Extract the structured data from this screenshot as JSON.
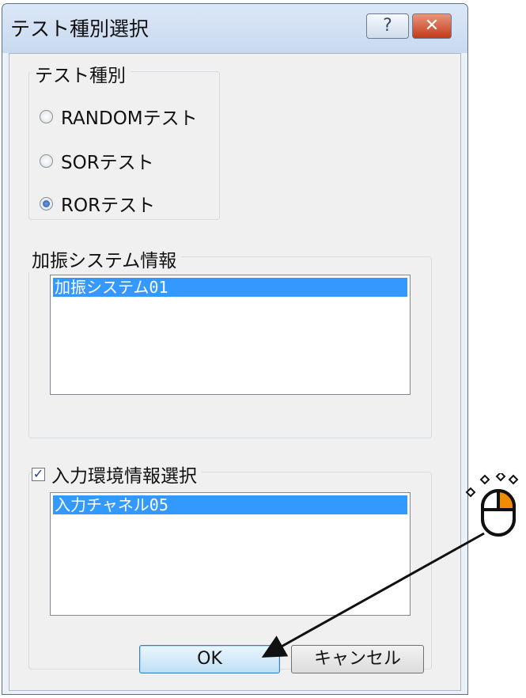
{
  "window": {
    "title": "テスト種別選択",
    "help_glyph": "?",
    "close_glyph": "✕"
  },
  "test_type": {
    "label": "テスト種別",
    "options": [
      {
        "label": "RANDOMテスト",
        "selected": false
      },
      {
        "label": "SORテスト",
        "selected": false
      },
      {
        "label": "RORテスト",
        "selected": true
      }
    ]
  },
  "vibration_system": {
    "label": "加振システム情報",
    "items": [
      "加振システム01"
    ],
    "selected_index": 0
  },
  "input_env": {
    "label": "入力環境情報選択",
    "checked": true,
    "check_glyph": "✓",
    "items": [
      "入力チャネル05"
    ],
    "selected_index": 0
  },
  "buttons": {
    "ok": "OK",
    "cancel": "キャンセル"
  },
  "colors": {
    "selection": "#3399ff",
    "mouse_highlight": "#f08c00"
  },
  "annotation": {
    "icon": "mouse-click-icon",
    "target": "ok-button"
  }
}
